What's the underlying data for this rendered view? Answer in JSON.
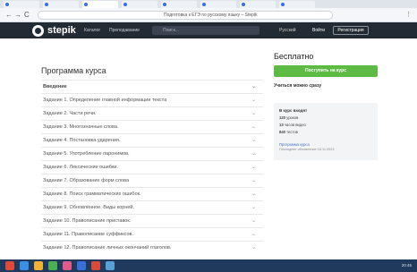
{
  "browser": {
    "page_title": "Подготовка к ЕГЭ по русскому языку – Stepik",
    "nav_back": "←",
    "nav_forward": "→",
    "nav_reload": "C"
  },
  "header": {
    "brand": "stepik",
    "nav": [
      "Каталог",
      "Преподавание"
    ],
    "search_placeholder": "Поиск...",
    "language": "Русский",
    "login": "Войти",
    "register": "Регистрация"
  },
  "program": {
    "title": "Программа курса",
    "items": [
      "Введение",
      "Задание 1. Определение главной информации текста",
      "Задание 2. Части речи.",
      "Задание 3. Многозначные слова.",
      "Задание 4. Постановка ударения.",
      "Задание 5. Употребление паронимов.",
      "Задание 6. Лексические ошибки.",
      "Задание 7. Образование форм слова",
      "Задание 8. Поиск грамматических ошибок.",
      "Задание 9. Обновлённое. Виды корней.",
      "Задание 10. Правописание приставок.",
      "Задание 11. Правописание суффиксов.",
      "Задание 12. Правописание личных окончаний глаголов."
    ],
    "chevron": "⌄"
  },
  "sidebar": {
    "price": "Бесплатно",
    "enroll_button": "Поступить на курс",
    "learn_now": "Учиться можно сразу",
    "includes_title": "В курс входят",
    "includes": [
      {
        "count": "120",
        "label": "уроков"
      },
      {
        "count": "13",
        "label": "часов видео"
      },
      {
        "count": "840",
        "label": "тестов"
      }
    ],
    "program_link": "Программа курса",
    "last_updated": "Последнее обновление 18.11.2023"
  },
  "colors": {
    "header_bg": "#222a33",
    "accent_green": "#5dbb44",
    "taskbar": "#1f3a5c"
  },
  "taskbar": {
    "time": "20:45"
  }
}
